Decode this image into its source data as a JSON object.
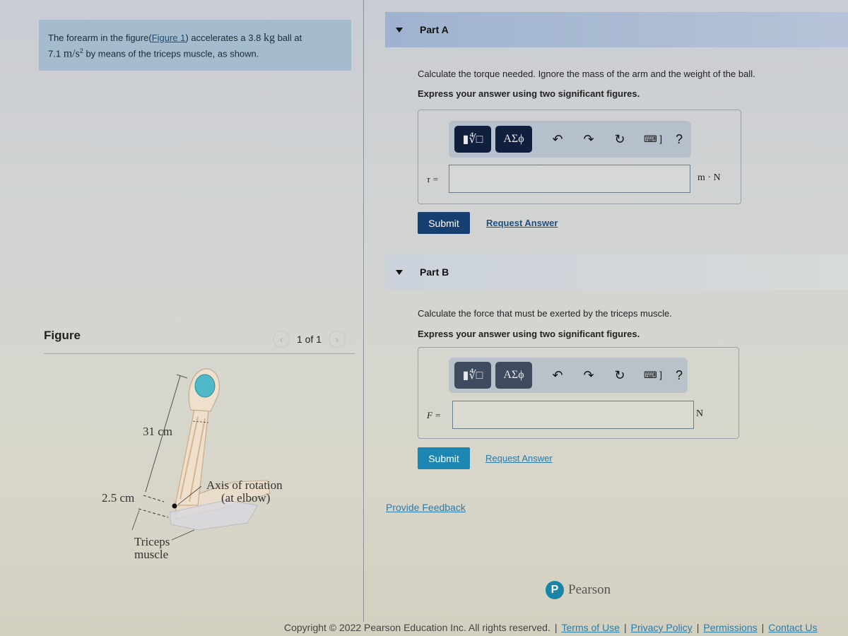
{
  "problem": {
    "text_before_link": "The forearm in the figure(",
    "figure_link": "Figure 1",
    "text_after_link": ") accelerates a 3.8 ",
    "mass_unit": "kg",
    "text_ball_at": " ball at",
    "accel_value": "7.1 ",
    "accel_unit": "m/s",
    "accel_exp": "2",
    "text_end": " by means of the triceps muscle, as shown."
  },
  "figure_panel": {
    "title": "Figure",
    "prev_icon": "‹",
    "next_icon": "›",
    "pager": "1 of 1",
    "labels": {
      "length_forearm": "31 cm",
      "length_triceps": "2.5 cm",
      "axis_line1": "Axis of rotation",
      "axis_line2": "(at elbow)",
      "triceps_line1": "Triceps",
      "triceps_line2": "muscle"
    }
  },
  "parts": [
    {
      "title": "Part A",
      "question": "Calculate the torque needed. Ignore the mass of the arm and the weight of the ball.",
      "instruction": "Express your answer using two significant figures.",
      "variable": "τ =",
      "input_value": "",
      "unit": "m · N",
      "submit_label": "Submit",
      "request_label": "Request Answer"
    },
    {
      "title": "Part B",
      "question": "Calculate the force that must be exerted by the triceps muscle.",
      "instruction": "Express your answer using two significant figures.",
      "variable": "F =",
      "input_value": "",
      "unit": "N",
      "submit_label": "Submit",
      "request_label": "Request Answer"
    }
  ],
  "toolbar": {
    "templates_label": "▮∜□",
    "greek_label": "ΑΣϕ",
    "undo": "↶",
    "redo": "↷",
    "reset": "↻",
    "keyboard": "⌨ ]",
    "help": "?"
  },
  "feedback_label": "Provide Feedback",
  "brand": {
    "logo_letter": "P",
    "name": "Pearson"
  },
  "footer": {
    "copyright": "Copyright © 2022 Pearson Education Inc. All rights reserved.",
    "links": [
      "Terms of Use",
      "Privacy Policy",
      "Permissions",
      "Contact Us"
    ]
  }
}
